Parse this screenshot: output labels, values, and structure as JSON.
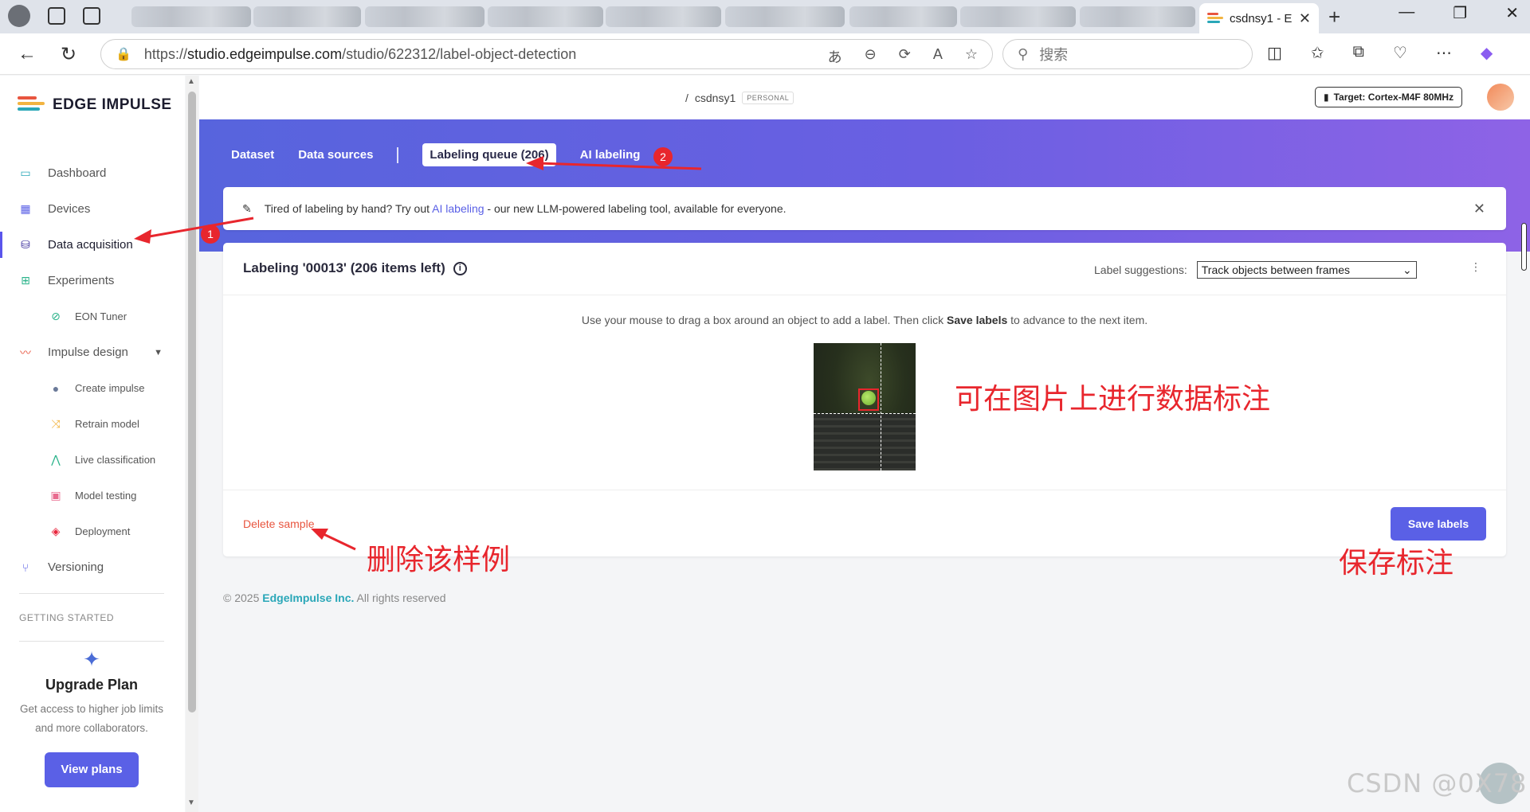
{
  "browser": {
    "active_tab_title": "csdnsy1 - E",
    "url_prefix": "https://",
    "url_host": "studio.edgeimpulse.com",
    "url_path": "/studio/622312/label-object-detection",
    "search_placeholder": "搜索"
  },
  "sidebar": {
    "brand": "EDGE IMPULSE",
    "items": [
      {
        "label": "Dashboard",
        "icon": "monitor-icon"
      },
      {
        "label": "Devices",
        "icon": "chip-icon"
      },
      {
        "label": "Data acquisition",
        "icon": "database-icon"
      },
      {
        "label": "Experiments",
        "icon": "grid-icon"
      },
      {
        "label": "EON Tuner",
        "icon": "compass-icon"
      },
      {
        "label": "Impulse design",
        "icon": "pulse-icon"
      },
      {
        "label": "Create impulse",
        "icon": "dot-icon"
      },
      {
        "label": "Retrain model",
        "icon": "shuffle-icon"
      },
      {
        "label": "Live classification",
        "icon": "nodes-icon"
      },
      {
        "label": "Model testing",
        "icon": "clipboard-icon"
      },
      {
        "label": "Deployment",
        "icon": "cube-icon"
      },
      {
        "label": "Versioning",
        "icon": "branch-icon"
      }
    ],
    "getting_started": "GETTING STARTED",
    "upgrade_title": "Upgrade Plan",
    "upgrade_text": "Get access to higher job limits and more collaborators.",
    "view_plans": "View plans"
  },
  "topbar": {
    "project_prefix": "/",
    "project_name": "csdnsy1",
    "project_badge": "PERSONAL",
    "target": "Target: Cortex-M4F 80MHz"
  },
  "subnav": {
    "tabs": [
      "Dataset",
      "Data sources",
      "Labeling queue (206)",
      "AI labeling"
    ]
  },
  "banner": {
    "text_before": "Tired of labeling by hand? Try out",
    "link": "AI labeling",
    "text_after": "- our new LLM-powered labeling tool, available for everyone."
  },
  "labeling": {
    "title": "Labeling '00013' (206 items left)",
    "suggestions_label": "Label suggestions:",
    "suggestions_value": "Track objects between frames",
    "instruction_before": "Use your mouse to drag a box around an object to add a label. Then click",
    "instruction_bold": "Save labels",
    "instruction_after": "to advance to the next item.",
    "delete": "Delete sample",
    "save": "Save labels"
  },
  "footer": {
    "copyright": "© 2025",
    "company": "EdgeImpulse Inc.",
    "rights": "All rights reserved"
  },
  "annotations": {
    "label_on_image": "可在图片上进行数据标注",
    "delete_note": "删除该样例",
    "save_note": "保存标注",
    "badge_1": "1",
    "badge_2": "2"
  },
  "watermark": "CSDN @0X78",
  "colors": {
    "accent": "#5a60e6",
    "annotation_red": "#e8262d",
    "delete_red": "#e8553f"
  }
}
